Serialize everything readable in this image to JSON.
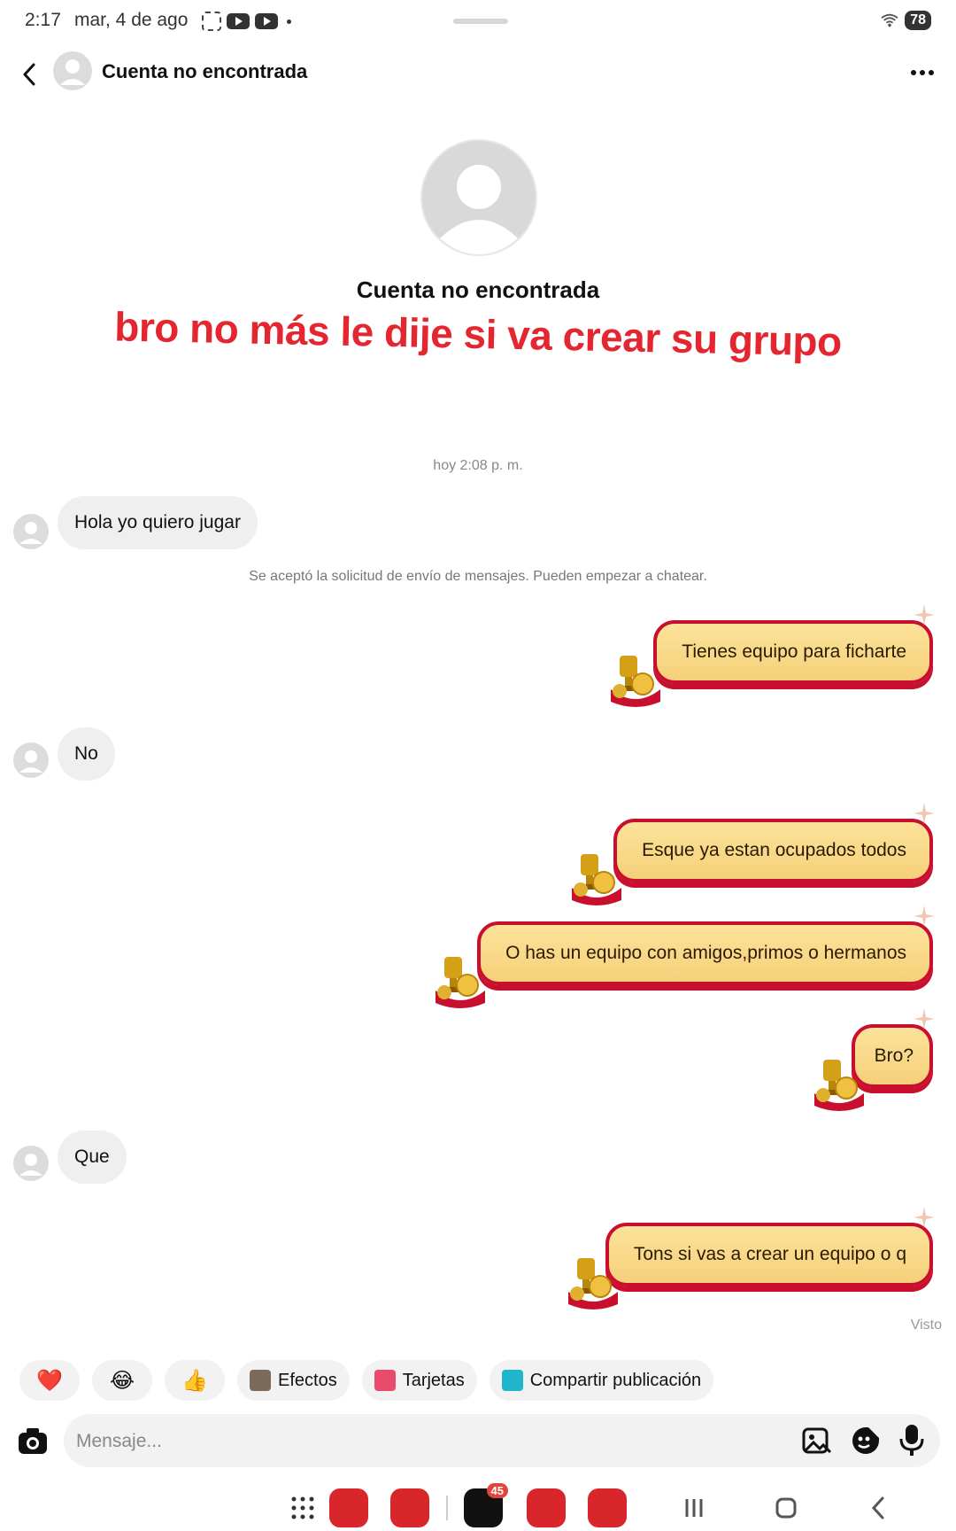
{
  "status_bar": {
    "time": "2:17",
    "date": "mar, 4 de ago",
    "battery": "78"
  },
  "header": {
    "title": "Cuenta no encontrada"
  },
  "profile": {
    "name": "Cuenta no encontrada"
  },
  "overlay_caption": "bro no más le dije si va crear su grupo",
  "timestamp": "hoy 2:08 p. m.",
  "system_note": "Se aceptó la solicitud de envío de mensajes. Pueden empezar a chatear.",
  "messages": {
    "m1": "Hola yo quiero jugar",
    "m2": "Tienes equipo para ficharte",
    "m3": "No",
    "m4": "Esque ya estan ocupados todos",
    "m5": "O has un equipo con amigos,primos o hermanos",
    "m6": "Bro?",
    "m7": "Que",
    "m8": "Tons si vas a crear un equipo o q"
  },
  "seen_label": "Visto",
  "quick_actions": {
    "heart": "❤️",
    "laugh": "😂",
    "thumbs": "👍",
    "effects": "Efectos",
    "cards": "Tarjetas",
    "share": "Compartir publicación"
  },
  "composer": {
    "placeholder": "Mensaje..."
  },
  "nav": {
    "tiktok_badge": "45"
  },
  "colors": {
    "caption_red": "#e3262f",
    "bubble_border": "#c8102e",
    "bubble_fill": "#fbe39a"
  }
}
